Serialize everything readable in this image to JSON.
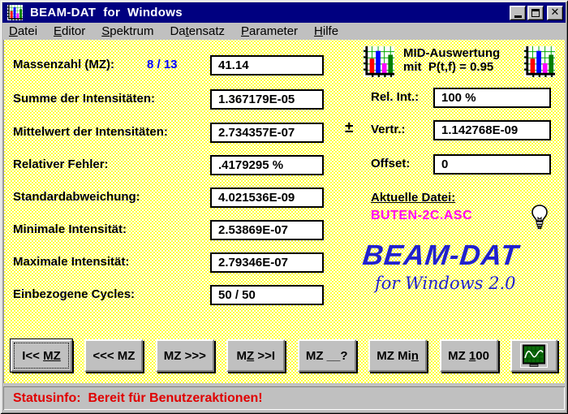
{
  "window": {
    "title": "BEAM-DAT  for  Windows",
    "controls": {
      "minimize": "minimize",
      "maximize": "maximize",
      "close_glyph": "✕"
    }
  },
  "menu": {
    "items": [
      {
        "pre": "",
        "key": "D",
        "post": "atei"
      },
      {
        "pre": "",
        "key": "E",
        "post": "ditor"
      },
      {
        "pre": "",
        "key": "S",
        "post": "pektrum"
      },
      {
        "pre": "Da",
        "key": "t",
        "post": "ensatz"
      },
      {
        "pre": "",
        "key": "P",
        "post": "arameter"
      },
      {
        "pre": "",
        "key": "H",
        "post": "ilfe"
      }
    ]
  },
  "fields": {
    "massenzahl": {
      "label": "Massenzahl (MZ):",
      "counter": "8 / 13",
      "value": "41.14"
    },
    "summe": {
      "label": "Summe der Intensitäten:",
      "value": "1.367179E-05"
    },
    "mittelwert": {
      "label": "Mittelwert der Intensitäten:",
      "value": "2.734357E-07"
    },
    "rel_fehler": {
      "label": "Relativer Fehler:",
      "value": ".4179295 %"
    },
    "stdabw": {
      "label": "Standardabweichung:",
      "value": "4.021536E-09"
    },
    "min_int": {
      "label": "Minimale Intensität:",
      "value": "2.53869E-07"
    },
    "max_int": {
      "label": "Maximale Intensität:",
      "value": "2.79346E-07"
    },
    "cycles": {
      "label": "Einbezogene Cycles:",
      "value": "50 / 50"
    }
  },
  "mid": {
    "line1": "MID-Auswertung",
    "line2": "mit  P(t,f) = 0.95"
  },
  "right": {
    "rel_int": {
      "label": "Rel. Int.:",
      "value": "100 %"
    },
    "vertr": {
      "prefix": "±",
      "label": "Vertr.:",
      "value": "1.142768E-09"
    },
    "offset": {
      "label": "Offset:",
      "value": "0"
    }
  },
  "file": {
    "label": "Aktuelle Datei:",
    "name": "BUTEN-2C.ASC"
  },
  "logo": {
    "title": "BEAM-DAT",
    "subtitle": "for Windows 2.0"
  },
  "buttons": [
    {
      "pre": "I<< ",
      "key": "MZ",
      "post": ""
    },
    {
      "pre": "<<< MZ",
      "key": "",
      "post": ""
    },
    {
      "pre": "MZ >>>",
      "key": "",
      "post": ""
    },
    {
      "pre": "M",
      "key": "Z",
      "post": " >>I"
    },
    {
      "pre": "MZ __?",
      "key": "",
      "post": ""
    },
    {
      "pre": "MZ Mi",
      "key": "n",
      "post": ""
    },
    {
      "pre": "MZ ",
      "key": "1",
      "post": "00"
    }
  ],
  "statusbar": {
    "text": "Statusinfo:  Bereit für Benutzeraktionen!"
  },
  "icons": {
    "app": "bar-chart-icon",
    "mid_left": "bar-chart-icon",
    "mid_right": "bar-chart-icon",
    "bulb": "lightbulb-icon",
    "graph_button": "oscilloscope-icon"
  },
  "colors": {
    "titlebar": "#000080",
    "counter_blue": "#0000ff",
    "file_magenta": "#ff00ff",
    "status_red": "#e00000",
    "logo_blue": "#2121cd",
    "face_gray": "#c0c0c0",
    "chart_bars": [
      "#ff0000",
      "#0000ff",
      "#ff00ff",
      "#008000"
    ]
  }
}
